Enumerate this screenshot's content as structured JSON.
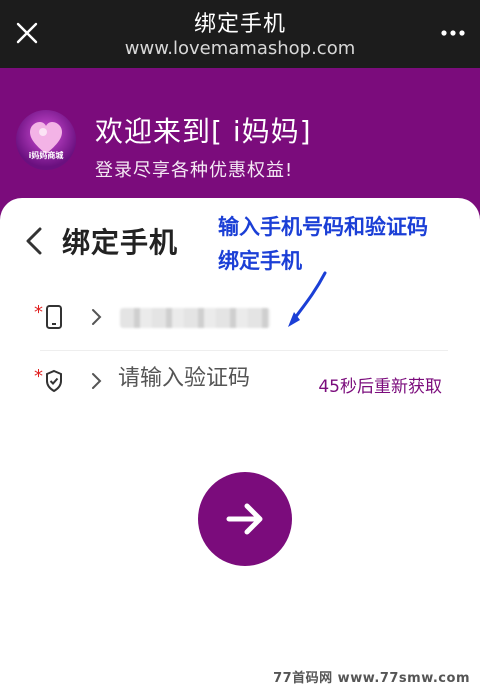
{
  "browser": {
    "title": "绑定手机",
    "url": "www.lovemamashop.com",
    "close_icon": "close-icon",
    "more_icon": "more-icon"
  },
  "hero": {
    "logo_text": "i妈妈商城",
    "welcome": "欢迎来到[ i妈妈]",
    "subtitle": "登录尽享各种优惠权益!",
    "background_color": "#7b0c7c"
  },
  "form": {
    "title": "绑定手机",
    "required_mark": "*",
    "phone": {
      "icon": "phone-icon",
      "value_obscured": true
    },
    "code": {
      "icon": "shield-icon",
      "placeholder": "请输入验证码",
      "resend_label": "45秒后重新获取"
    },
    "submit_icon": "arrow-right-icon",
    "accent_color": "#7b0c7c"
  },
  "annotation": {
    "line1": "输入手机号码和验证码",
    "line2": "绑定手机",
    "color": "#1b3fd6"
  },
  "watermark": "77首码网 www.77smw.com"
}
